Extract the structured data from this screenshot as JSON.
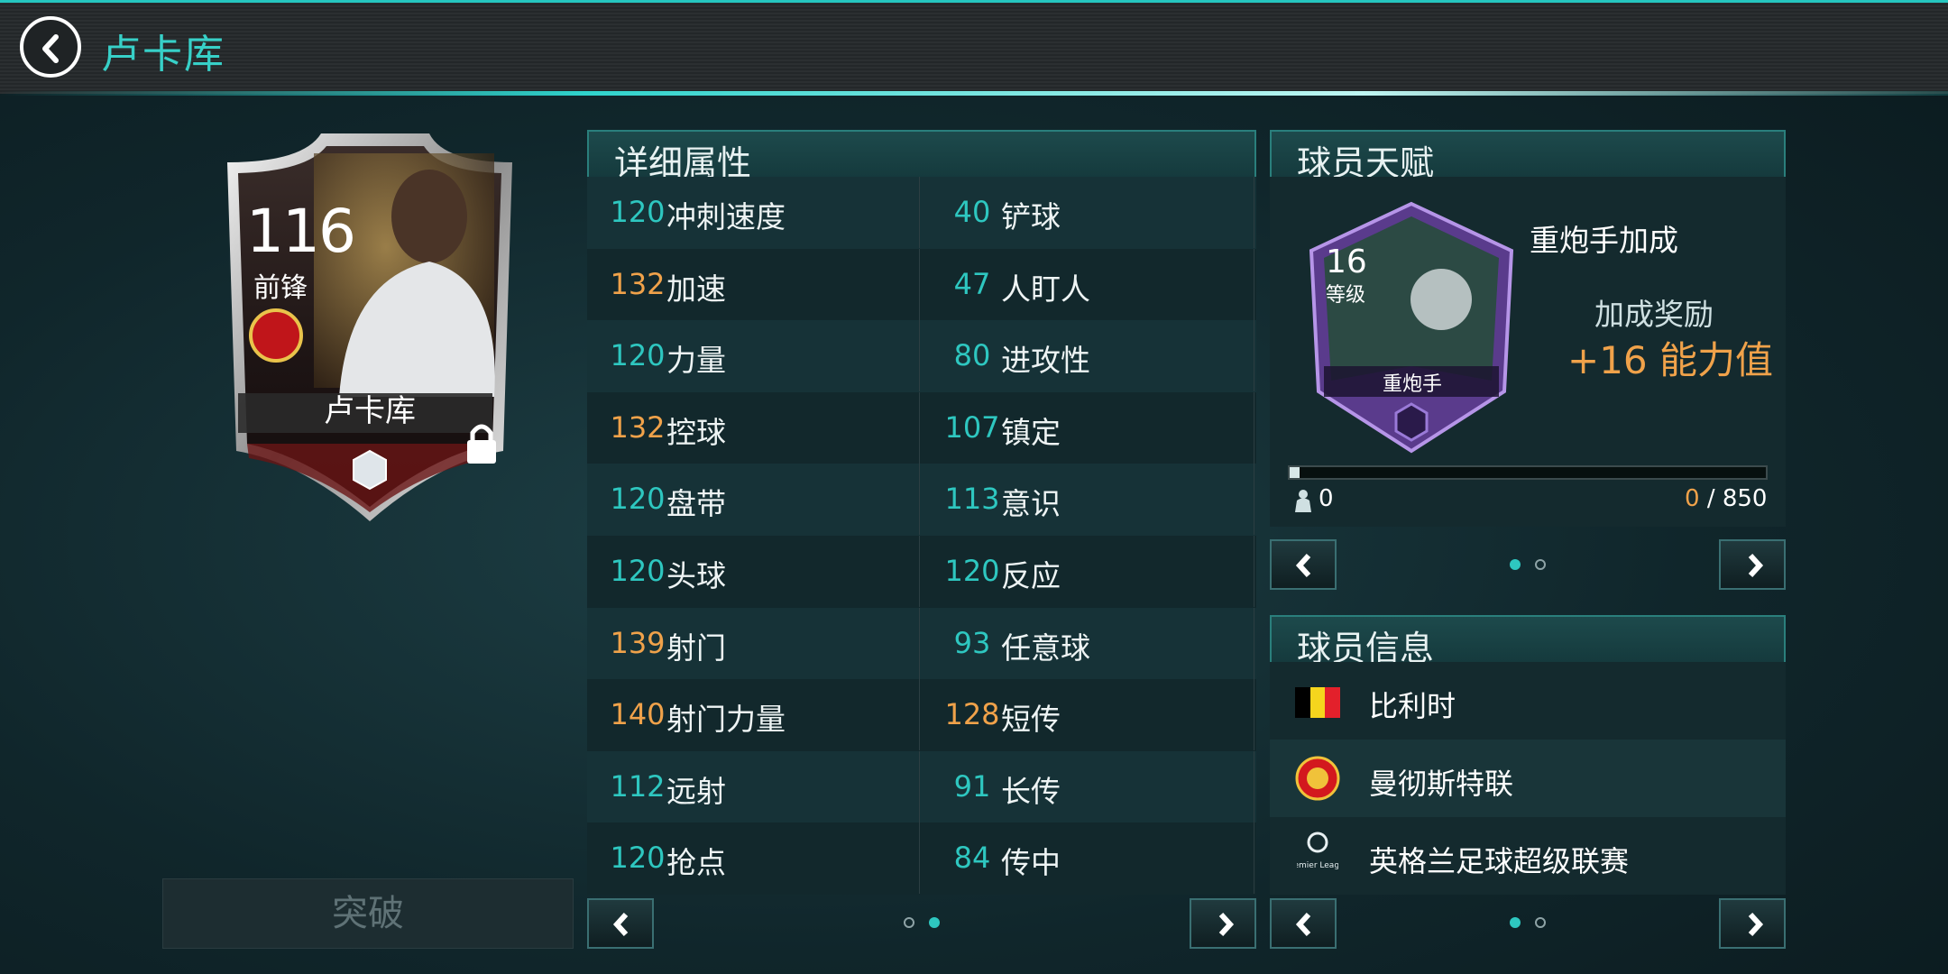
{
  "header": {
    "title": "卢卡库",
    "back_icon": "chevron-left-icon"
  },
  "player_card": {
    "rating": "116",
    "position": "前锋",
    "name": "卢卡库",
    "lock_icon": "lock-icon"
  },
  "breakthrough_label": "突破",
  "attributes": {
    "title": "详细属性",
    "rows": [
      {
        "left": {
          "value": "120",
          "name": "冲刺速度",
          "color": "teal"
        },
        "right": {
          "value": "40",
          "name": "铲球",
          "color": "teal"
        }
      },
      {
        "left": {
          "value": "132",
          "name": "加速",
          "color": "orange"
        },
        "right": {
          "value": "47",
          "name": "人盯人",
          "color": "teal"
        }
      },
      {
        "left": {
          "value": "120",
          "name": "力量",
          "color": "teal"
        },
        "right": {
          "value": "80",
          "name": "进攻性",
          "color": "teal"
        }
      },
      {
        "left": {
          "value": "132",
          "name": "控球",
          "color": "orange"
        },
        "right": {
          "value": "107",
          "name": "镇定",
          "color": "teal"
        }
      },
      {
        "left": {
          "value": "120",
          "name": "盘带",
          "color": "teal"
        },
        "right": {
          "value": "113",
          "name": "意识",
          "color": "teal"
        }
      },
      {
        "left": {
          "value": "120",
          "name": "头球",
          "color": "teal"
        },
        "right": {
          "value": "120",
          "name": "反应",
          "color": "teal"
        }
      },
      {
        "left": {
          "value": "139",
          "name": "射门",
          "color": "orange"
        },
        "right": {
          "value": "93",
          "name": "任意球",
          "color": "teal"
        }
      },
      {
        "left": {
          "value": "140",
          "name": "射门力量",
          "color": "orange"
        },
        "right": {
          "value": "128",
          "name": "短传",
          "color": "orange"
        }
      },
      {
        "left": {
          "value": "112",
          "name": "远射",
          "color": "teal"
        },
        "right": {
          "value": "91",
          "name": "长传",
          "color": "teal"
        }
      },
      {
        "left": {
          "value": "120",
          "name": "抢点",
          "color": "teal"
        },
        "right": {
          "value": "84",
          "name": "传中",
          "color": "teal"
        }
      }
    ],
    "page": 2,
    "pages": 2
  },
  "talent": {
    "title": "球员天赋",
    "name": "重炮手加成",
    "level": "16",
    "level_label": "等级",
    "badge_name": "重炮手",
    "bonus_label": "加成奖励",
    "bonus_value": "+16 能力值",
    "progress_left": "0",
    "progress_current": "0",
    "progress_total": "/ 850",
    "progress_fraction": 0.02,
    "page": 1,
    "pages": 2
  },
  "player_info": {
    "title": "球员信息",
    "nationality": "比利时",
    "club": "曼彻斯特联",
    "league": "英格兰足球超级联赛",
    "league_logo_text": "Premier League",
    "page": 1,
    "pages": 2
  },
  "colors": {
    "accent": "#2ec7c0",
    "highlight": "#f0a24a",
    "background": "#10262b"
  }
}
